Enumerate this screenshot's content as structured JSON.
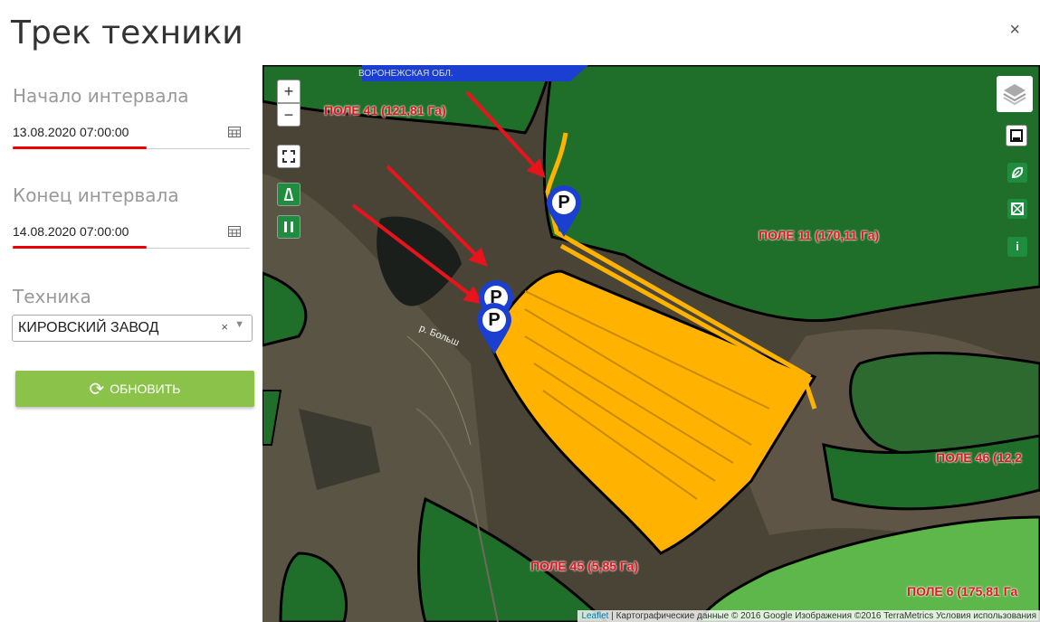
{
  "dialog": {
    "title": "Трек техники",
    "close_label": "×"
  },
  "form": {
    "start_label": "Начало интервала",
    "start_value": "13.08.2020 07:00:00",
    "end_label": "Конец интервала",
    "end_value": "14.08.2020 07:00:00",
    "vehicle_label": "Техника",
    "vehicle_value": "КИРОВСКИЙ ЗАВОД",
    "vehicle_clear": "×",
    "vehicle_arrow": "▼",
    "refresh_icon": "⟳",
    "refresh_label": "ОБНОВИТЬ"
  },
  "map": {
    "zoom_in": "+",
    "zoom_out": "−",
    "region_label": "ВОРОНЕЖСКАЯ ОБЛ.",
    "fields": {
      "f41": "ПОЛЕ 41 (121,81 Га)",
      "f11": "ПОЛЕ 11 (170,11 Га)",
      "f46": "ПОЛЕ 46 (12,2",
      "f45": "ПОЛЕ 45 (5,85 Га)",
      "f6": "ПОЛЕ 6 (175,81 Га"
    },
    "river_label": "р. Больш",
    "parking_marker": "P",
    "info_label": "i",
    "attribution": {
      "leaflet": "Leaflet",
      "rest": " | Картографические данные © 2016 Google Изображения ©2016 TerraMetrics Условия использования"
    },
    "colors": {
      "field": "#1f6f2a",
      "light_field": "#5db74a",
      "track": "#ffb300",
      "arrow": "#e8141c",
      "marker": "#1a3fd1",
      "label": "#e8141c"
    }
  }
}
